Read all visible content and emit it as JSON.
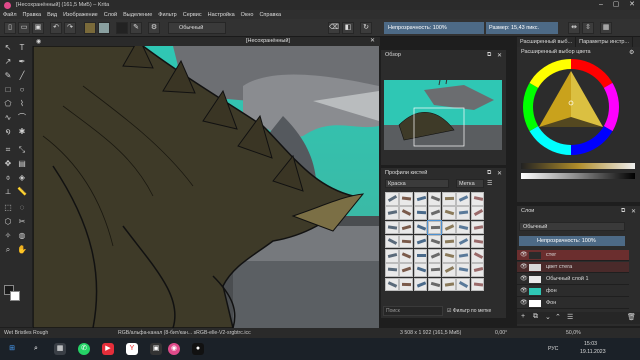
{
  "window": {
    "title": "[Несохранённый] (161,5 МиБ)  – Krita"
  },
  "menu": [
    "Файл",
    "Правка",
    "Вид",
    "Изображение",
    "Слой",
    "Выделение",
    "Фильтр",
    "Сервис",
    "Настройка",
    "Окно",
    "Справка"
  ],
  "toolbar": {
    "blend_mode": "Обычный",
    "opacity": "Непрозрачность: 100%",
    "size": "Размер: 15,43 пикс."
  },
  "canvas": {
    "tab_title": "[Несохранённый]"
  },
  "overview": {
    "title": "Обзор"
  },
  "brush_presets": {
    "title": "Профили кистей",
    "tag": "Краска",
    "tag_button": "Метка",
    "search_placeholder": "Поиск",
    "filter_label": "Фильтр по метке"
  },
  "right_tabs": [
    "Расширенный выб...",
    "Параметры инстр..."
  ],
  "color_panel": {
    "title": "Расширенный выбор цвета"
  },
  "layers": {
    "title": "Слои",
    "blend_mode": "Обычный",
    "opacity": "Непрозрачность: 100%",
    "items": [
      {
        "name": "стег",
        "selected": true
      },
      {
        "name": "цвет стега",
        "selected": false
      },
      {
        "name": "Обычный слой 1",
        "selected": false
      },
      {
        "name": "фон",
        "selected": false
      },
      {
        "name": "Фон",
        "selected": false
      }
    ]
  },
  "status": {
    "brush": "Wet Bristles Rough",
    "colorspace": "RGB/альфа-канал (8-бит/кан...  sRGB-elle-V2-srgbtrc.icc",
    "dimensions": "3 508 x 1 922 (161,5 МиБ)",
    "rotation": "0,00°",
    "zoom": "50,0%"
  },
  "taskbar": {
    "lang": "РУС",
    "time": "15:03",
    "date": "19.11.2023"
  },
  "colors": {
    "accent": "#4d6a86",
    "teal": "#27b8a6",
    "selected_layer": "#6b2e2e"
  }
}
